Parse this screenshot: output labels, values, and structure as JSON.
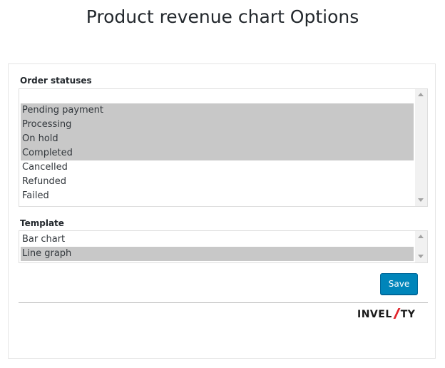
{
  "page": {
    "title": "Product revenue chart Options"
  },
  "order_statuses": {
    "label": "Order statuses",
    "options": [
      {
        "label": "Pending payment",
        "selected": true
      },
      {
        "label": "Processing",
        "selected": true
      },
      {
        "label": "On hold",
        "selected": true
      },
      {
        "label": "Completed",
        "selected": true
      },
      {
        "label": "Cancelled",
        "selected": false
      },
      {
        "label": "Refunded",
        "selected": false
      },
      {
        "label": "Failed",
        "selected": false
      }
    ]
  },
  "template": {
    "label": "Template",
    "options": [
      {
        "label": "Bar chart",
        "selected": false
      },
      {
        "label": "Line graph",
        "selected": true
      }
    ]
  },
  "actions": {
    "save_label": "Save"
  },
  "branding": {
    "logo_left": "INVEL",
    "logo_right": "TY",
    "accent_color": "#e2262d"
  },
  "colors": {
    "button": "#0085ba",
    "selection": "#c8c8c8"
  }
}
